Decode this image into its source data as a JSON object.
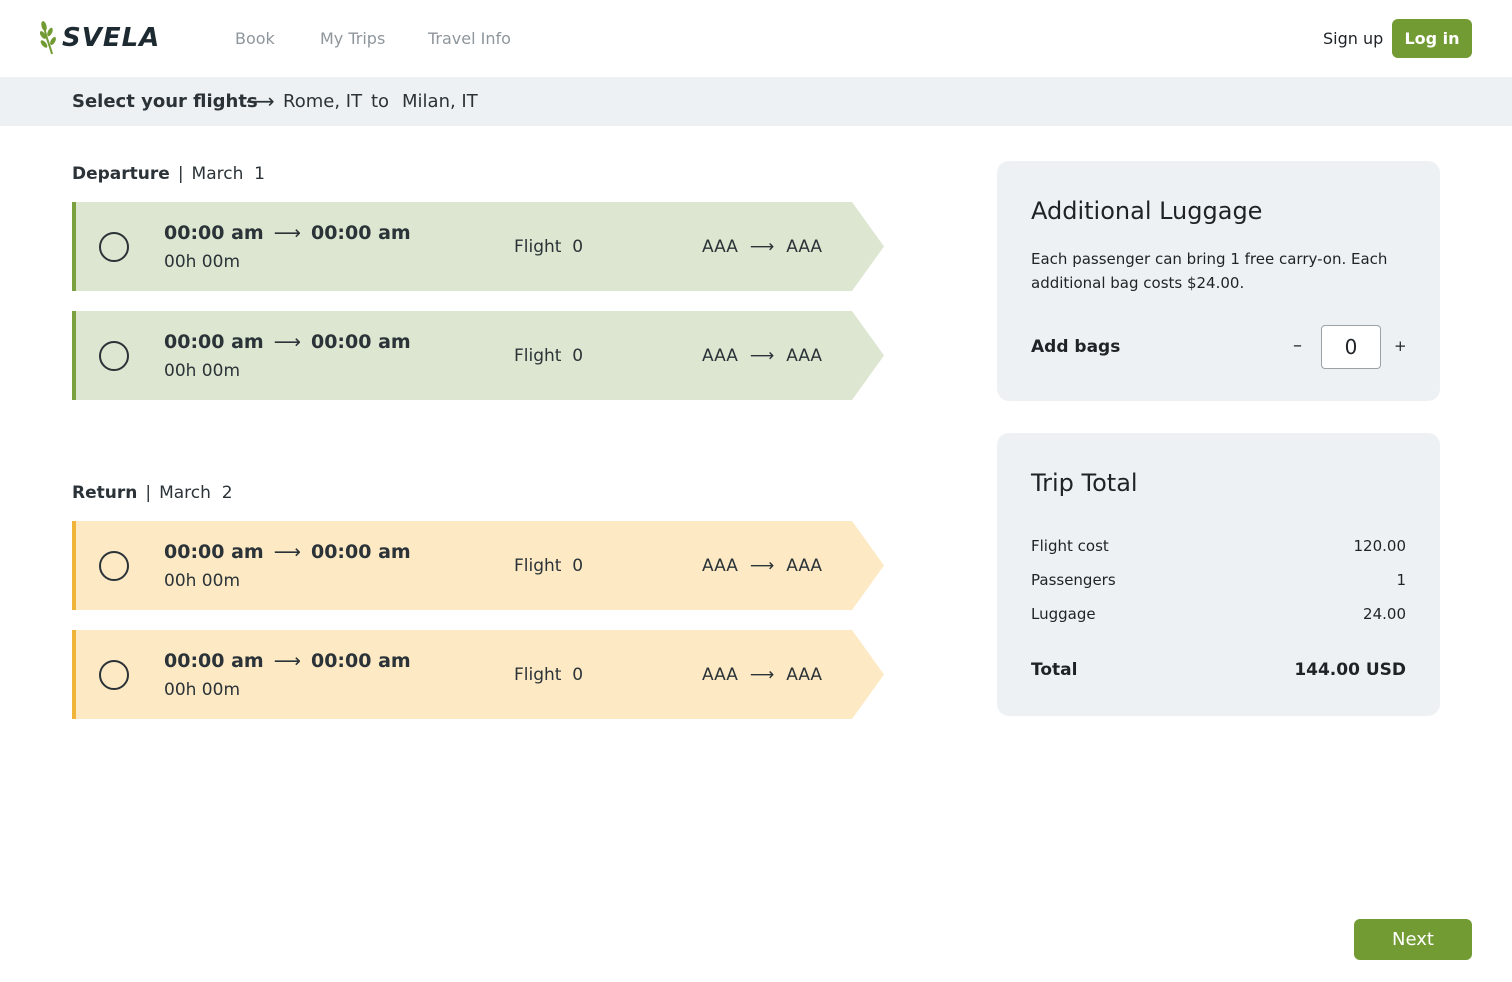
{
  "brand": {
    "name": "SVELA",
    "accent": "#739b33"
  },
  "nav": {
    "book": "Book",
    "trips": "My Trips",
    "info": "Travel Info"
  },
  "auth": {
    "signup": "Sign up",
    "login": "Log in"
  },
  "breadcrumb": {
    "title": "Select your flights",
    "arrow": "⟶",
    "from": "Rome, IT",
    "to_word": "to",
    "to": "Milan, IT"
  },
  "departure": {
    "label": "Departure",
    "sep": "|",
    "date": "March  1",
    "color": "#dde6d0",
    "border": "#7aa03f",
    "flights": [
      {
        "depart": "00:00 am",
        "arrive": "00:00 am",
        "duration": "00h 00m",
        "flight": "Flight  0",
        "from": "AAA",
        "to": "AAA"
      },
      {
        "depart": "00:00 am",
        "arrive": "00:00 am",
        "duration": "00h 00m",
        "flight": "Flight  0",
        "from": "AAA",
        "to": "AAA"
      }
    ]
  },
  "return": {
    "label": "Return",
    "sep": "|",
    "date": "March  2",
    "color": "#fdeac4",
    "border": "#f0b43a",
    "flights": [
      {
        "depart": "00:00 am",
        "arrive": "00:00 am",
        "duration": "00h 00m",
        "flight": "Flight  0",
        "from": "AAA",
        "to": "AAA"
      },
      {
        "depart": "00:00 am",
        "arrive": "00:00 am",
        "duration": "00h 00m",
        "flight": "Flight  0",
        "from": "AAA",
        "to": "AAA"
      }
    ]
  },
  "arrow": "⟶",
  "luggage": {
    "title": "Additional Luggage",
    "description": "Each passenger can bring 1 free carry-on. Each additional bag costs $24.00.",
    "add_label": "Add bags",
    "minus": "–",
    "plus": "+",
    "quantity": "0"
  },
  "total": {
    "title": "Trip Total",
    "rows": [
      {
        "label": "Flight cost",
        "value": "120.00"
      },
      {
        "label": "Passengers",
        "value": "1"
      },
      {
        "label": "Luggage",
        "value": "24.00"
      }
    ],
    "total_label": "Total",
    "total_value": "144.00 USD"
  },
  "next_label": "Next"
}
